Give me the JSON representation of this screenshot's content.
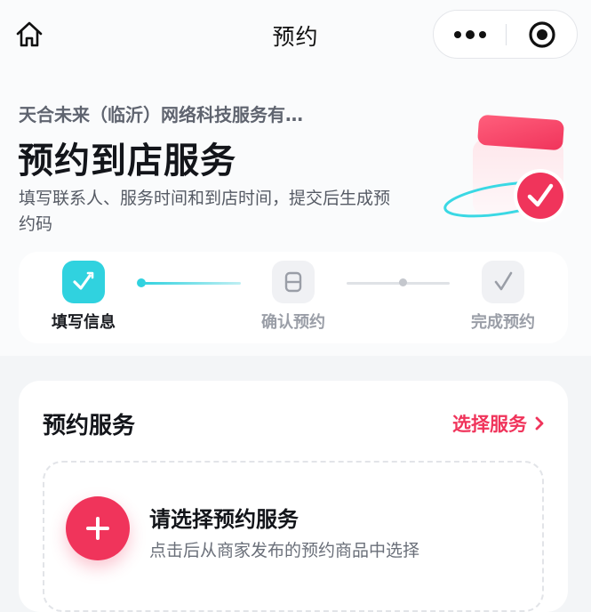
{
  "nav": {
    "title": "预约",
    "home_icon": "home-icon",
    "more_icon": "more-dots-icon",
    "close_icon": "target-close-icon"
  },
  "header": {
    "merchant": "天合未来（临沂）网络科技服务有…",
    "title": "预约到店服务",
    "description": "填写联系人、服务时间和到店时间，提交后生成预约码"
  },
  "steps": [
    {
      "label": "填写信息",
      "state": "active",
      "icon": "edit-check-icon"
    },
    {
      "label": "确认预约",
      "state": "inactive",
      "icon": "document-icon"
    },
    {
      "label": "完成预约",
      "state": "inactive",
      "icon": "check-icon"
    }
  ],
  "service": {
    "section_title": "预约服务",
    "choose_label": "选择服务",
    "picker_title": "请选择预约服务",
    "picker_subtitle": "点击后从商家发布的预约商品中选择"
  },
  "colors": {
    "accent_red": "#f0345b",
    "accent_cyan": "#30d2df",
    "muted_text": "#9a9ea7"
  }
}
